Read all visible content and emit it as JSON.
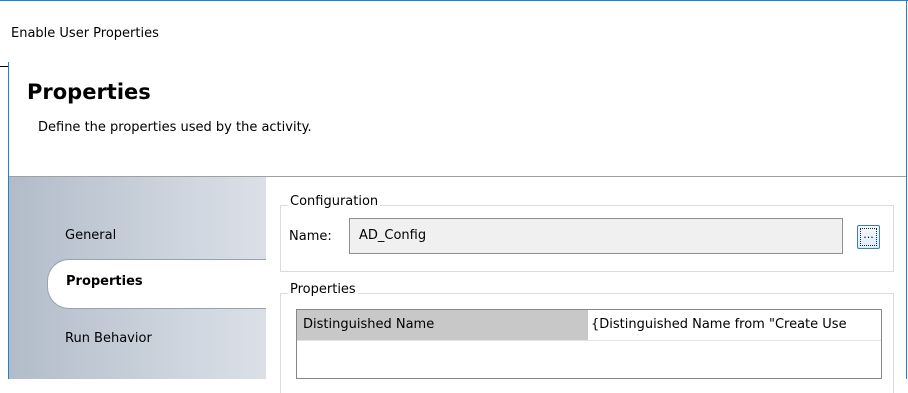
{
  "window": {
    "title": "Enable User Properties"
  },
  "header": {
    "title": "Properties",
    "subtitle": "Define the properties used by the activity."
  },
  "nav": {
    "items": [
      {
        "label": "General"
      },
      {
        "label": "Properties"
      },
      {
        "label": "Run Behavior"
      }
    ],
    "selected": "Properties"
  },
  "configuration": {
    "legend": "Configuration",
    "name_label": "Name:",
    "name_value": "AD_Config",
    "browse_label": "..."
  },
  "properties": {
    "legend": "Properties",
    "rows": [
      {
        "key": "Distinguished Name",
        "value": "{Distinguished Name from \"Create Use"
      }
    ]
  }
}
